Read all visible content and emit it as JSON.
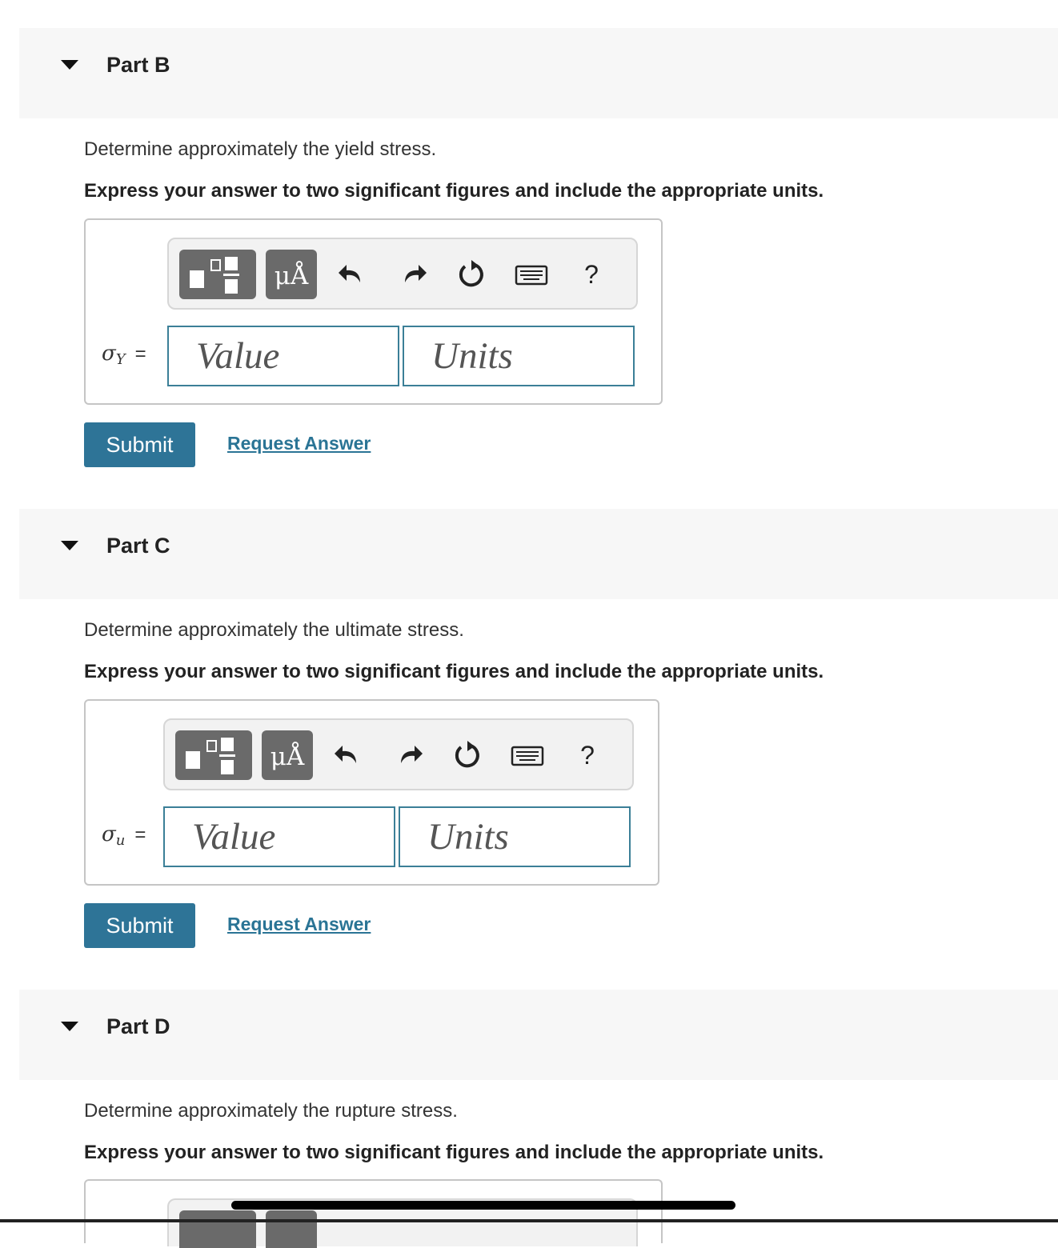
{
  "parts": [
    {
      "title": "Part B",
      "question": "Determine approximately the yield stress.",
      "instruction": "Express your answer to two significant figures and include the appropriate units.",
      "variable": {
        "symbol": "σ",
        "subscript": "Y",
        "equals": "="
      },
      "value_placeholder": "Value",
      "units_placeholder": "Units",
      "toolbar": {
        "units_button": "μÅ",
        "help": "?"
      },
      "submit_label": "Submit",
      "request_label": "Request Answer"
    },
    {
      "title": "Part C",
      "question": "Determine approximately the ultimate stress.",
      "instruction": "Express your answer to two significant figures and include the appropriate units.",
      "variable": {
        "symbol": "σ",
        "subscript": "u",
        "equals": "="
      },
      "value_placeholder": "Value",
      "units_placeholder": "Units",
      "toolbar": {
        "units_button": "μÅ",
        "help": "?"
      },
      "submit_label": "Submit",
      "request_label": "Request Answer"
    },
    {
      "title": "Part D",
      "question": "Determine approximately the rupture stress.",
      "instruction": "Express your answer to two significant figures and include the appropriate units."
    }
  ],
  "colors": {
    "accent": "#2e7497",
    "field_border": "#3b7f97",
    "header_bg": "#f7f7f7"
  }
}
